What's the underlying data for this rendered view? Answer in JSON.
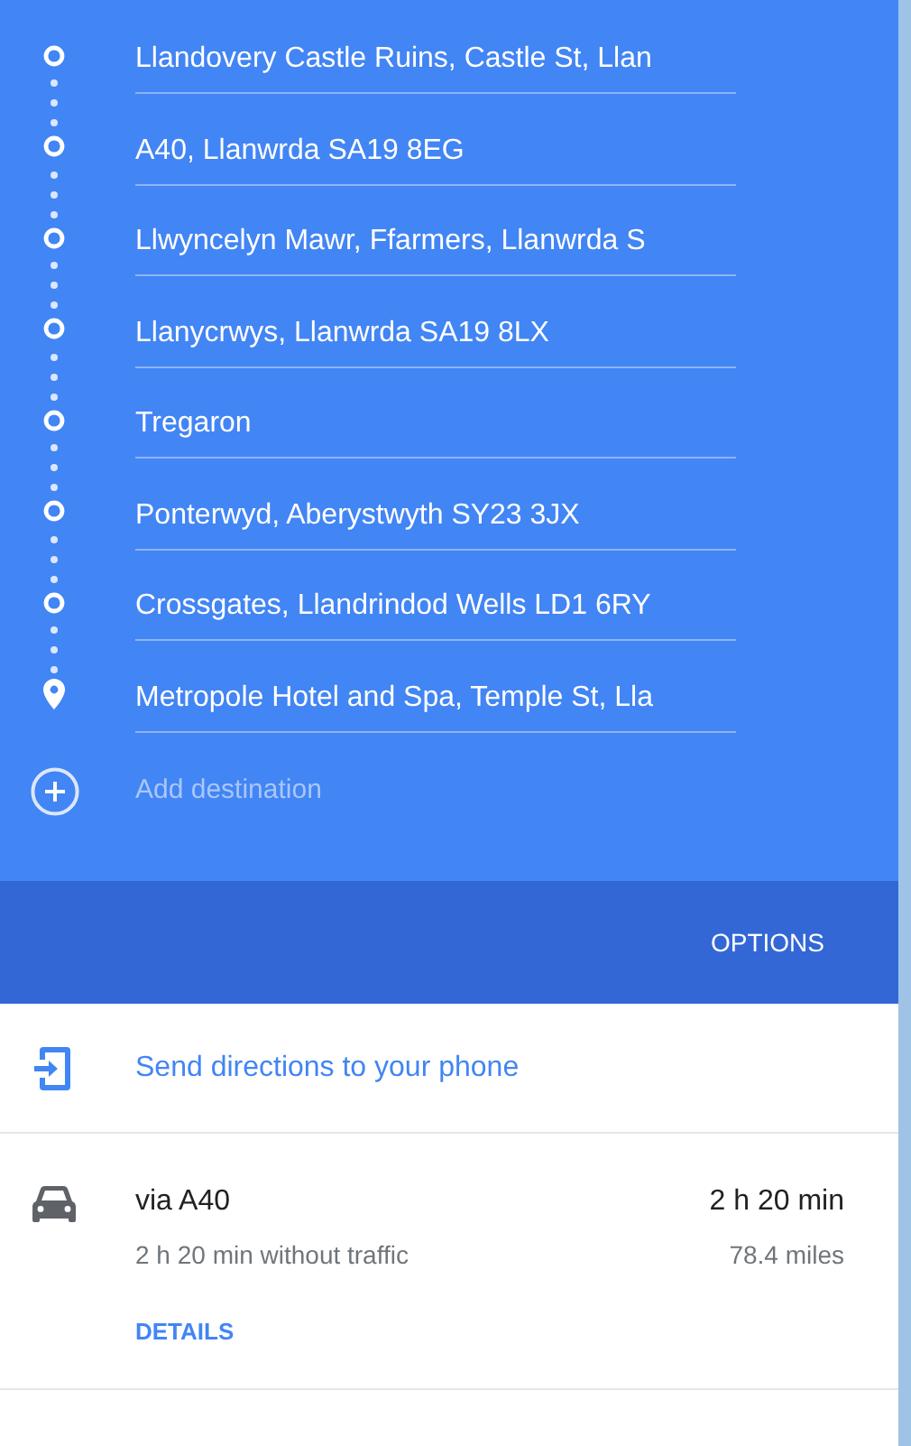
{
  "stops": [
    {
      "kind": "waypoint",
      "value": "Llandovery Castle Ruins, Castle St, Llan"
    },
    {
      "kind": "waypoint",
      "value": "A40, Llanwrda SA19 8EG"
    },
    {
      "kind": "waypoint",
      "value": "Llwyncelyn Mawr, Ffarmers, Llanwrda S"
    },
    {
      "kind": "waypoint",
      "value": "Llanycrwys, Llanwrda SA19 8LX"
    },
    {
      "kind": "waypoint",
      "value": "Tregaron"
    },
    {
      "kind": "waypoint",
      "value": "Ponterwyd, Aberystwyth SY23 3JX"
    },
    {
      "kind": "waypoint",
      "value": "Crossgates, Llandrindod Wells LD1 6RY"
    },
    {
      "kind": "destination",
      "value": "Metropole Hotel and Spa, Temple St, Lla"
    }
  ],
  "add_destination": {
    "placeholder": "Add destination"
  },
  "options_button": "OPTIONS",
  "send_to_phone": "Send directions to your phone",
  "route": {
    "title": "via A40",
    "duration": "2 h 20 min",
    "note": "2 h 20 min without traffic",
    "distance": "78.4 miles",
    "details_link": "DETAILS"
  }
}
